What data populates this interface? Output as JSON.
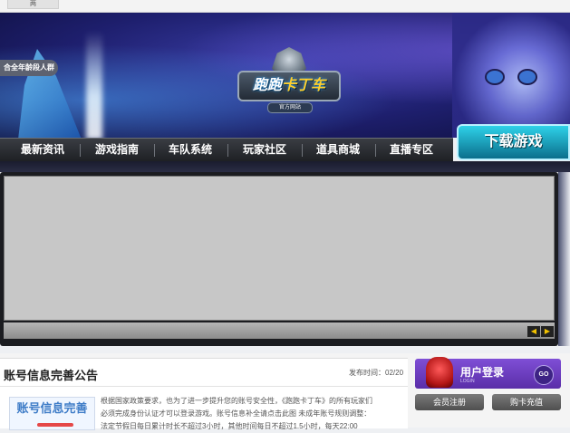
{
  "tab": {
    "label": "两"
  },
  "banner": {
    "promo": "合全年龄段人群",
    "logo_text_a": "跑跑",
    "logo_text_b": "卡丁车",
    "logo_tag": "官方网站"
  },
  "nav": {
    "items": [
      "最新资讯",
      "游戏指南",
      "车队系统",
      "玩家社区",
      "道具商城",
      "直播专区"
    ],
    "download": "下载游戏"
  },
  "slider": {
    "prev": "◀",
    "next": "▶"
  },
  "announcement": {
    "title": "账号信息完善公告",
    "date": "发布时间：02/20",
    "thumb": "账号信息完善",
    "lines": [
      "根据国家政策要求，也为了进一步提升您的账号安全性，《跑跑卡丁车》的所有玩家们",
      "必须完成身份认证才可以登录游戏。账号信息补全请点击此图 未成年账号规则调整：",
      "法定节假日每日累计时长不超过3小时，其他时间每日不超过1.5小时，每天22:00"
    ]
  },
  "login": {
    "label": "用户登录",
    "sub": "LOGIN",
    "go": "GO"
  },
  "buttons": {
    "register": "会员注册",
    "recharge": "购卡充值"
  }
}
